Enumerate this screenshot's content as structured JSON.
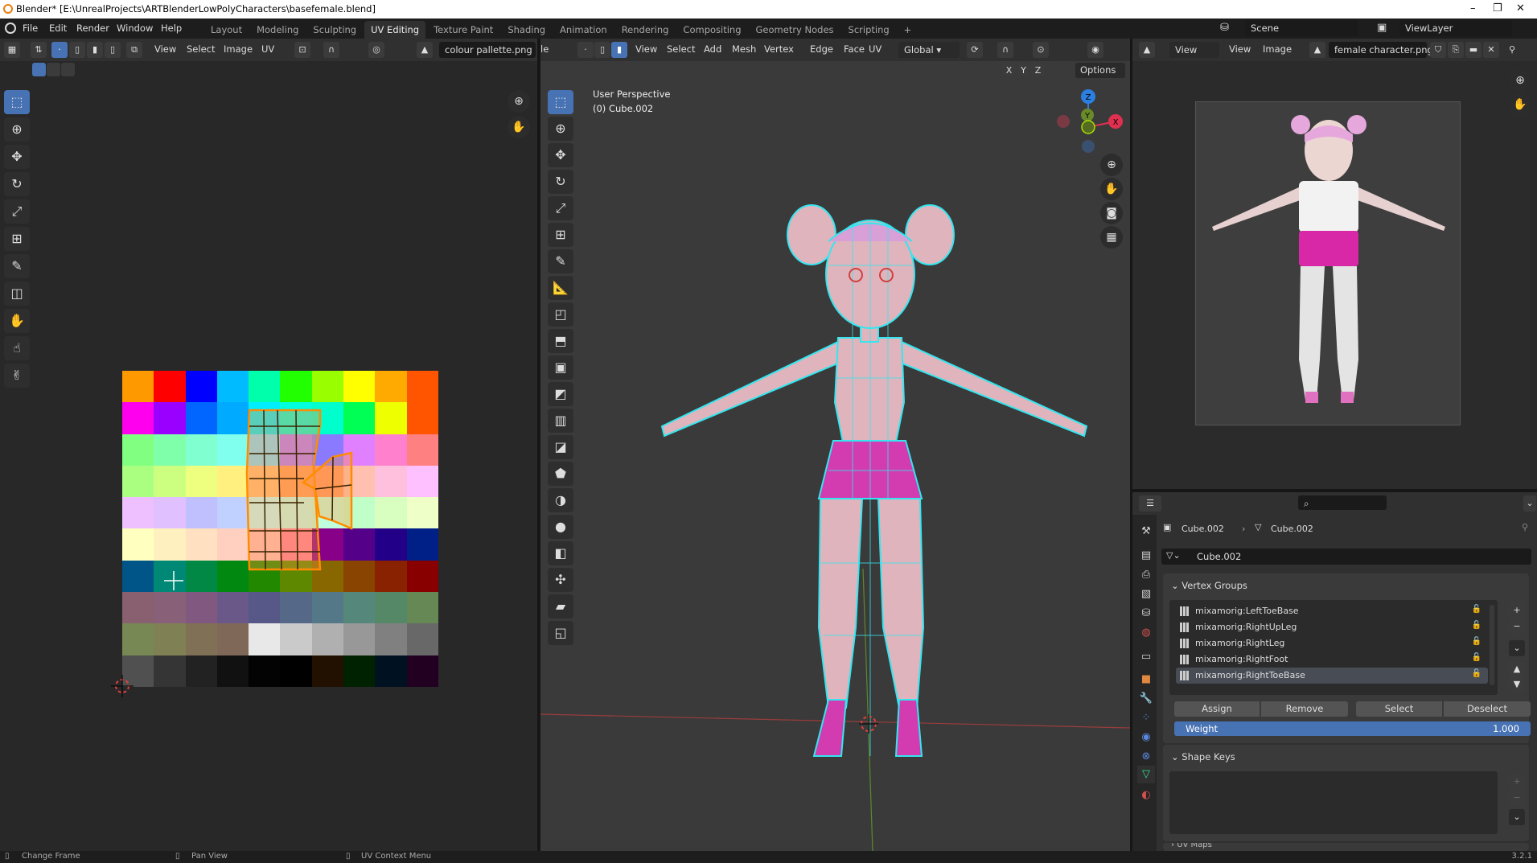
{
  "window": {
    "title": "Blender* [E:\\UnrealProjects\\ARTBlenderLowPolyCharacters\\basefemale.blend]",
    "minimize": "–",
    "maximize": "❐",
    "close": "✕"
  },
  "menu": [
    "File",
    "Edit",
    "Render",
    "Window",
    "Help"
  ],
  "workspaces": [
    "Layout",
    "Modeling",
    "Sculpting",
    "UV Editing",
    "Texture Paint",
    "Shading",
    "Animation",
    "Rendering",
    "Compositing",
    "Geometry Nodes",
    "Scripting",
    "+"
  ],
  "active_workspace": "UV Editing",
  "scene": {
    "name": "Scene",
    "view_layer": "ViewLayer"
  },
  "uv_editor": {
    "menus": [
      "View",
      "Select",
      "Image",
      "UV"
    ],
    "image_name": "colour pallette.png",
    "tools": [
      "select-box-icon",
      "cursor-icon",
      "move-icon",
      "rotate-icon",
      "scale-icon",
      "transform-icon",
      "annotate-icon",
      "rip-icon",
      "grab-icon",
      "relax-icon",
      "pinch-icon"
    ],
    "palette": [
      [
        "#ff9900",
        "#ff0000",
        "#0000ff",
        "#00bbff",
        "#00ffaa",
        "#22ff00",
        "#99ff00",
        "#ffff00",
        "#ffaa00",
        "#ff5500"
      ],
      [
        "#ff00ee",
        "#9900ff",
        "#0066ff",
        "#00aaff",
        "#00eeff",
        "#00ffdd",
        "#00ffcc",
        "#00ff55",
        "#eeff00",
        "#ff5500"
      ],
      [
        "#80ff80",
        "#80ffaa",
        "#80ffd0",
        "#80ffee",
        "#80ddff",
        "#b080ff",
        "#8a7aff",
        "#e080ff",
        "#ff80cc",
        "#ff8080"
      ],
      [
        "#aaff80",
        "#ccff80",
        "#eeff80",
        "#fff080",
        "#ffc080",
        "#ffa060",
        "#ff9966",
        "#ffc0b0",
        "#ffc0dd",
        "#ffc0ff"
      ],
      [
        "#eec0ff",
        "#e0c0ff",
        "#c0c0ff",
        "#c0d0ff",
        "#c0ffff",
        "#c0ffee",
        "#c0ffdd",
        "#c0ffc8",
        "#d8ffc0",
        "#eeffc8"
      ],
      [
        "#ffffc0",
        "#fff0c0",
        "#ffe0c0",
        "#ffd0c0",
        "#ffc0c0",
        "#ff80a0",
        "#880088",
        "#550088",
        "#220088",
        "#002088"
      ],
      [
        "#005588",
        "#008877",
        "#008844",
        "#008811",
        "#228800",
        "#5e8800",
        "#886600",
        "#884400",
        "#882200",
        "#880000"
      ],
      [
        "#886070",
        "#886078",
        "#805880",
        "#6a5888",
        "#585888",
        "#556888",
        "#557888",
        "#55887a",
        "#558866",
        "#668855"
      ],
      [
        "#778855",
        "#808055",
        "#807055",
        "#806858",
        "#e8e8e8",
        "#cacaca",
        "#b0b0b0",
        "#989898",
        "#808080",
        "#686868"
      ],
      [
        "#505050",
        "#353535",
        "#222222",
        "#111111",
        "#030303",
        "#000000",
        "#221100",
        "#002200",
        "#001122",
        "#220022"
      ]
    ]
  },
  "viewport": {
    "mode_fragment": "le",
    "menus": [
      "View",
      "Select",
      "Add",
      "Mesh",
      "Vertex",
      "Edge",
      "Face",
      "UV"
    ],
    "orientation": "Global",
    "axes": [
      "X",
      "Y",
      "Z"
    ],
    "options": "Options",
    "perspective": "User Perspective",
    "object": "(0) Cube.002",
    "gizmo": {
      "x": "X",
      "y": "Y",
      "z": "Z"
    },
    "tools": [
      "select-box-icon",
      "cursor-icon",
      "move-icon",
      "rotate-icon",
      "scale-icon",
      "transform-icon",
      "annotate-icon",
      "measure-icon",
      "add-cube-icon",
      "extrude-icon",
      "inset-icon",
      "bevel-icon",
      "loop-cut-icon",
      "knife-icon",
      "poly-build-icon",
      "spin-icon",
      "smooth-icon",
      "edge-slide-icon",
      "shrink-icon",
      "shear-icon",
      "rip-region-icon"
    ]
  },
  "image_editor": {
    "view_dropdown": "View",
    "menus": [
      "View",
      "Image"
    ],
    "image_name": "female character.png"
  },
  "properties": {
    "breadcrumb": [
      "Cube.002",
      "Cube.002"
    ],
    "mesh_name": "Cube.002",
    "vertex_groups_title": "Vertex Groups",
    "vertex_groups": [
      "mixamorig:LeftToeBase",
      "mixamorig:RightUpLeg",
      "mixamorig:RightLeg",
      "mixamorig:RightFoot",
      "mixamorig:RightToeBase"
    ],
    "selected_group": "mixamorig:RightToeBase",
    "buttons": [
      "Assign",
      "Remove",
      "Select",
      "Deselect"
    ],
    "weight_label": "Weight",
    "weight_value": "1.000",
    "shape_keys_title": "Shape Keys",
    "uv_maps_title": "UV Maps"
  },
  "status": {
    "items": [
      "Change Frame",
      "Pan View",
      "UV Context Menu"
    ],
    "version": "3.2.1"
  },
  "colors": {
    "accent": "#4772b3",
    "uv_edge": "#ff8c00",
    "wire": "#33e6f0",
    "mesh": "#e0b4bc",
    "skirt": "#d23cb0"
  }
}
